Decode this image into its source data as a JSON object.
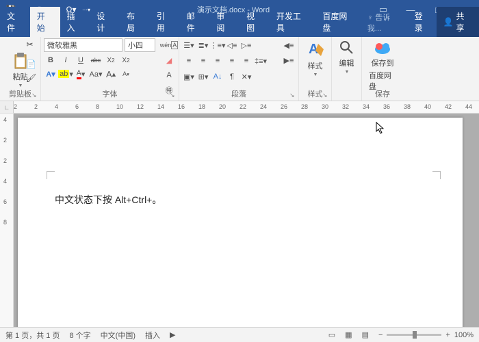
{
  "titlebar": {
    "doc": "演示文档.docx - Word"
  },
  "tabs": {
    "file": "文件",
    "home": "开始",
    "insert": "插入",
    "design": "设计",
    "layout": "布局",
    "ref": "引用",
    "mail": "邮件",
    "review": "审阅",
    "view": "视图",
    "dev": "开发工具",
    "baidu": "百度网盘",
    "tell": "♀ 告诉我...",
    "login": "登录",
    "share": "共享"
  },
  "ribbon": {
    "clipboard": {
      "label": "剪贴板",
      "paste": "粘贴"
    },
    "font": {
      "label": "字体",
      "name": "微软雅黑",
      "size": "小四",
      "b": "B",
      "i": "I",
      "u": "U",
      "strike": "abc",
      "x2": "X",
      "x2sup": "2",
      "x2sub": "2"
    },
    "para": {
      "label": "段落"
    },
    "styles": {
      "label": "样式",
      "btn": "样式"
    },
    "editing": {
      "label": "",
      "btn": "编辑"
    },
    "save": {
      "label": "保存",
      "btn1": "保存到",
      "btn2": "百度网盘"
    }
  },
  "ruler": {
    "marks": [
      "2",
      "2",
      "4",
      "6",
      "8",
      "10",
      "12",
      "14",
      "16",
      "18",
      "20",
      "22",
      "24",
      "26",
      "28",
      "30",
      "32",
      "34",
      "36",
      "38",
      "40",
      "42",
      "44"
    ]
  },
  "rulerv": {
    "marks": [
      "4",
      "2",
      "2",
      "4",
      "6",
      "8"
    ]
  },
  "document": {
    "text": "中文状态下按 Alt+Ctrl+。"
  },
  "status": {
    "page": "第 1 页，共 1 页",
    "words": "8 个字",
    "lang": "中文(中国)",
    "mode": "插入",
    "zoom": "100%",
    "minus": "−",
    "plus": "+"
  }
}
